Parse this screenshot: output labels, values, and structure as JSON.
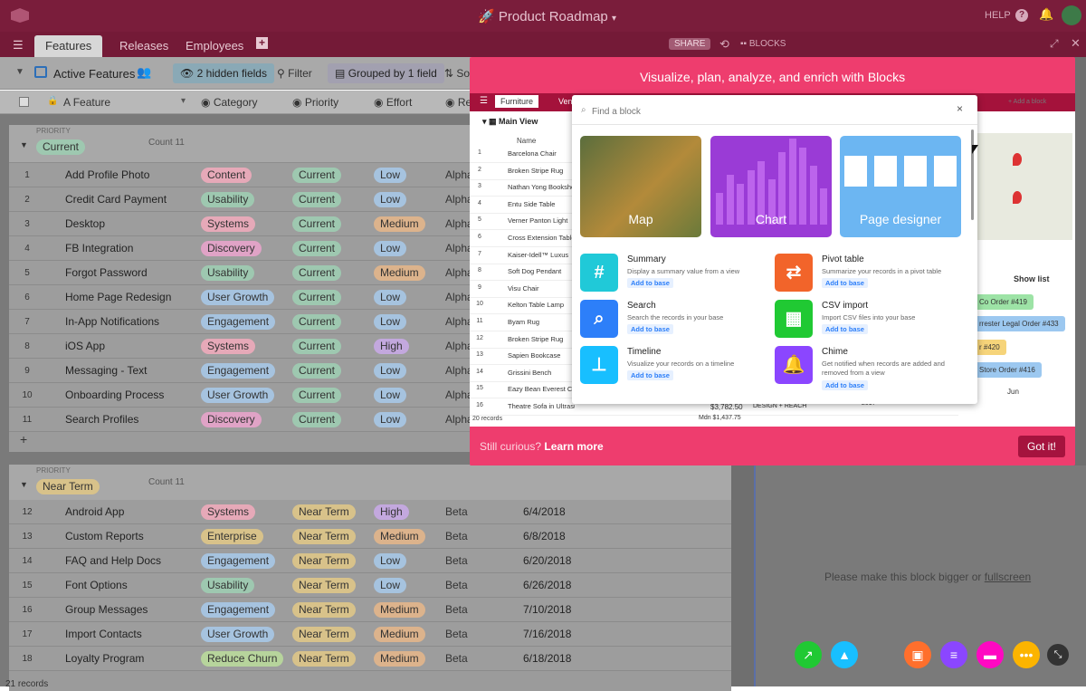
{
  "app": {
    "title": "Product Roadmap",
    "help": "HELP",
    "share": "SHARE",
    "blocks": "BLOCKS"
  },
  "tabs": [
    "Features",
    "Releases",
    "Employees"
  ],
  "view": {
    "name": "Active Features",
    "hidden": "2 hidden fields",
    "filter": "Filter",
    "grouped": "Grouped by 1 field",
    "sort": "So"
  },
  "columns": [
    "Feature",
    "Category",
    "Priority",
    "Effort",
    "Re"
  ],
  "groups": [
    {
      "label_small": "PRIORITY",
      "name": "Current",
      "count": "Count 11"
    },
    {
      "label_small": "PRIORITY",
      "name": "Near Term",
      "count": "Count 11"
    }
  ],
  "rows_current": [
    {
      "n": "1",
      "f": "Add Profile Photo",
      "cat": "Content",
      "p": "Current",
      "e": "Low",
      "r": "Alpha"
    },
    {
      "n": "2",
      "f": "Credit Card Payment",
      "cat": "Usability",
      "p": "Current",
      "e": "Low",
      "r": "Alpha"
    },
    {
      "n": "3",
      "f": "Desktop",
      "cat": "Systems",
      "p": "Current",
      "e": "Medium",
      "r": "Alpha"
    },
    {
      "n": "4",
      "f": "FB Integration",
      "cat": "Discovery",
      "p": "Current",
      "e": "Low",
      "r": "Alpha"
    },
    {
      "n": "5",
      "f": "Forgot Password",
      "cat": "Usability",
      "p": "Current",
      "e": "Medium",
      "r": "Alpha"
    },
    {
      "n": "6",
      "f": "Home Page Redesign",
      "cat": "User Growth",
      "p": "Current",
      "e": "Low",
      "r": "Alpha"
    },
    {
      "n": "7",
      "f": "In-App Notifications",
      "cat": "Engagement",
      "p": "Current",
      "e": "Low",
      "r": "Alpha"
    },
    {
      "n": "8",
      "f": "iOS App",
      "cat": "Systems",
      "p": "Current",
      "e": "High",
      "r": "Alpha"
    },
    {
      "n": "9",
      "f": "Messaging - Text",
      "cat": "Engagement",
      "p": "Current",
      "e": "Low",
      "r": "Alpha"
    },
    {
      "n": "10",
      "f": "Onboarding Process",
      "cat": "User Growth",
      "p": "Current",
      "e": "Low",
      "r": "Alpha"
    },
    {
      "n": "11",
      "f": "Search Profiles",
      "cat": "Discovery",
      "p": "Current",
      "e": "Low",
      "r": "Alpha"
    }
  ],
  "rows_near": [
    {
      "n": "12",
      "f": "Android App",
      "cat": "Systems",
      "p": "Near Term",
      "e": "High",
      "r": "Beta",
      "d": "6/4/2018"
    },
    {
      "n": "13",
      "f": "Custom Reports",
      "cat": "Enterprise",
      "p": "Near Term",
      "e": "Medium",
      "r": "Beta",
      "d": "6/8/2018"
    },
    {
      "n": "14",
      "f": "FAQ and Help Docs",
      "cat": "Engagement",
      "p": "Near Term",
      "e": "Low",
      "r": "Beta",
      "d": "6/20/2018"
    },
    {
      "n": "15",
      "f": "Font Options",
      "cat": "Usability",
      "p": "Near Term",
      "e": "Low",
      "r": "Beta",
      "d": "6/26/2018"
    },
    {
      "n": "16",
      "f": "Group Messages",
      "cat": "Engagement",
      "p": "Near Term",
      "e": "Medium",
      "r": "Beta",
      "d": "7/10/2018"
    },
    {
      "n": "17",
      "f": "Import Contacts",
      "cat": "User Growth",
      "p": "Near Term",
      "e": "Medium",
      "r": "Beta",
      "d": "7/16/2018"
    },
    {
      "n": "18",
      "f": "Loyalty Program",
      "cat": "Reduce Churn",
      "p": "Near Term",
      "e": "Medium",
      "r": "Beta",
      "d": "6/18/2018"
    }
  ],
  "records": "21 records",
  "catcolors": {
    "Content": "#e6a9b8",
    "Usability": "#9ec8b0",
    "Systems": "#e6a9b8",
    "Discovery": "#e0a3c6",
    "User Growth": "#a6c3df",
    "Engagement": "#a6c3df",
    "Enterprise": "#d8c28a",
    "Reduce Churn": "#b7d49c"
  },
  "effcolors": {
    "Low": "#a6c3df",
    "Medium": "#dcb38c",
    "High": "#c3a8de"
  },
  "modal": {
    "title": "Visualize, plan, analyze, and enrich with Blocks",
    "curious": "Still curious?",
    "learn": "Learn more",
    "got": "Got it!",
    "search_ph": "Find a block",
    "close": "×",
    "tiles": [
      "Map",
      "Chart",
      "Page designer"
    ],
    "blocks": [
      {
        "name": "Summary",
        "desc": "Display a summary value from a view",
        "add": "Add to base",
        "color": "#20c9d8",
        "glyph": "#"
      },
      {
        "name": "Pivot table",
        "desc": "Summarize your records in a pivot table",
        "add": "Add to base",
        "color": "#f2642a",
        "glyph": "⇄"
      },
      {
        "name": "Search",
        "desc": "Search the records in your base",
        "add": "Add to base",
        "color": "#2d7ff9",
        "glyph": "⌕"
      },
      {
        "name": "CSV import",
        "desc": "Import CSV files into your base",
        "add": "Add to base",
        "color": "#20c933",
        "glyph": "▦"
      },
      {
        "name": "Timeline",
        "desc": "Visualize your records on a timeline",
        "add": "Add to base",
        "color": "#18bfff",
        "glyph": "⊥"
      },
      {
        "name": "Chime",
        "desc": "Get notified when records are added and removed from a view",
        "add": "Add to base",
        "color": "#8b46ff",
        "glyph": "🔔"
      }
    ],
    "bg": {
      "tab": "Furniture",
      "tab2": "Ven",
      "view": "Main View",
      "namecol": "Name",
      "add_block": "+ Add a block",
      "show_list": "Show list",
      "items": [
        "Barcelona Chair",
        "Broken Stripe Rug",
        "Nathan Yong Bookshelf",
        "Entu Side Table",
        "Verner Panton Light",
        "Cross Extension Table",
        "Kaiser-Idell™ Luxus",
        "Soft Dog Pendant",
        "Visu Chair",
        "Kelton Table Lamp",
        "Byam Rug",
        "Broken Stripe Rug",
        "Sapien Bookcase",
        "Grissini Bench",
        "Eazy Bean Everest Chair",
        "Theatre Sofa in Ultrasuede"
      ],
      "records": "20 records",
      "sum": "$3,782.50",
      "med": "Mdn $1,437.75",
      "tag": "DESIGN + REACH",
      "orders": [
        "Co Order #419",
        "rrester Legal Order #433",
        "r #420",
        "Store Order #416"
      ],
      "jun": "Jun",
      "year": "2017"
    }
  },
  "right": {
    "msg": "Please make this block bigger or",
    "link": "fullscreen"
  },
  "dock_colors": [
    "#20c933",
    "#18bfff",
    "#ff6f2c",
    "#8b46ff",
    "#ff08c2",
    "#fcb400",
    "#333333"
  ]
}
